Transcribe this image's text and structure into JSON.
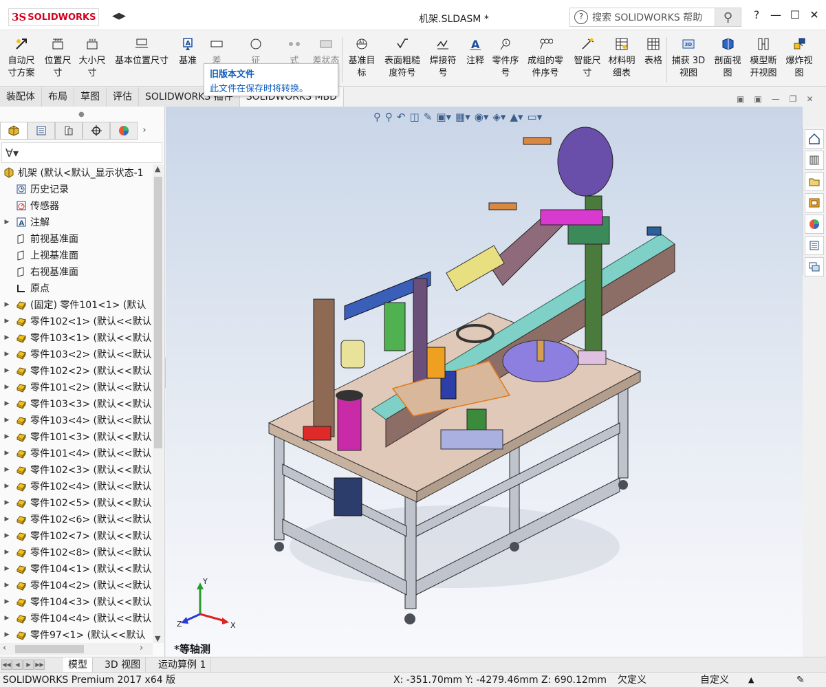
{
  "app": {
    "logo_ds": "3S",
    "logo_text": "SOLIDWORKS",
    "document_title": "机架.SLDASM *",
    "search_placeholder": "搜索 SOLIDWORKS 帮助",
    "help_label": "?"
  },
  "toolbar": {
    "items": [
      {
        "label": "自动尺\n寸方案",
        "icon": "auto-dimension-icon"
      },
      {
        "label": "位置尺\n寸",
        "icon": "location-dimension-icon"
      },
      {
        "label": "大小尺\n寸",
        "icon": "size-dimension-icon"
      },
      {
        "label": "基本位置尺寸",
        "icon": "basic-location-icon"
      },
      {
        "label": "基准",
        "icon": "datum-icon"
      },
      {
        "label": "差",
        "icon": "tolerance-icon"
      },
      {
        "label": "征",
        "icon": "feature-icon"
      },
      {
        "label": "式",
        "icon": "pattern-icon"
      },
      {
        "label": "差状态",
        "icon": "tolerance-status-icon"
      },
      {
        "label": "基准目\n标",
        "icon": "datum-target-icon"
      },
      {
        "label": "表面粗糙\n度符号",
        "icon": "surface-finish-icon"
      },
      {
        "label": "焊接符\n号",
        "icon": "weld-symbol-icon"
      },
      {
        "label": "注释",
        "icon": "note-icon"
      },
      {
        "label": "零件序\n号",
        "icon": "balloon-icon"
      },
      {
        "label": "成组的零\n件序号",
        "icon": "stacked-balloon-icon"
      },
      {
        "label": "智能尺\n寸",
        "icon": "smart-dimension-icon"
      },
      {
        "label": "材料明\n细表",
        "icon": "bom-icon"
      },
      {
        "label": "表格",
        "icon": "table-icon"
      },
      {
        "label": "捕获 3D\n视图",
        "icon": "capture-3d-view-icon"
      },
      {
        "label": "剖面视\n图",
        "icon": "section-view-icon"
      },
      {
        "label": "模型断\n开视图",
        "icon": "break-view-icon"
      },
      {
        "label": "爆炸视\n图",
        "icon": "explode-view-icon"
      }
    ],
    "tooltip_title": "旧版本文件",
    "tooltip_body": "此文件在保存时将转换。"
  },
  "tabs": [
    "装配体",
    "布局",
    "草图",
    "评估",
    "SOLIDWORKS 插件",
    "SOLIDWORKS MBD"
  ],
  "active_tab": "SOLIDWORKS MBD",
  "tree": {
    "root": "机架  (默认<默认_显示状态-1",
    "items": [
      {
        "label": "历史记录",
        "icon": "history-icon",
        "expand": false
      },
      {
        "label": "传感器",
        "icon": "sensor-icon",
        "expand": false
      },
      {
        "label": "注解",
        "icon": "annotation-icon",
        "expand": true
      },
      {
        "label": "前视基准面",
        "icon": "plane-icon",
        "expand": false
      },
      {
        "label": "上视基准面",
        "icon": "plane-icon",
        "expand": false
      },
      {
        "label": "右视基准面",
        "icon": "plane-icon",
        "expand": false
      },
      {
        "label": "原点",
        "icon": "origin-icon",
        "expand": false
      },
      {
        "label": "(固定) 零件101<1> (默认",
        "icon": "part-icon",
        "expand": true
      },
      {
        "label": "零件102<1> (默认<<默认",
        "icon": "part-icon",
        "expand": true
      },
      {
        "label": "零件103<1> (默认<<默认",
        "icon": "part-icon",
        "expand": true
      },
      {
        "label": "零件103<2> (默认<<默认",
        "icon": "part-icon",
        "expand": true
      },
      {
        "label": "零件102<2> (默认<<默认",
        "icon": "part-icon",
        "expand": true
      },
      {
        "label": "零件101<2> (默认<<默认",
        "icon": "part-icon",
        "expand": true
      },
      {
        "label": "零件103<3> (默认<<默认",
        "icon": "part-icon",
        "expand": true
      },
      {
        "label": "零件103<4> (默认<<默认",
        "icon": "part-icon",
        "expand": true
      },
      {
        "label": "零件101<3> (默认<<默认",
        "icon": "part-icon",
        "expand": true
      },
      {
        "label": "零件101<4> (默认<<默认",
        "icon": "part-icon",
        "expand": true
      },
      {
        "label": "零件102<3> (默认<<默认",
        "icon": "part-icon",
        "expand": true
      },
      {
        "label": "零件102<4> (默认<<默认",
        "icon": "part-icon",
        "expand": true
      },
      {
        "label": "零件102<5> (默认<<默认",
        "icon": "part-icon",
        "expand": true
      },
      {
        "label": "零件102<6> (默认<<默认",
        "icon": "part-icon",
        "expand": true
      },
      {
        "label": "零件102<7> (默认<<默认",
        "icon": "part-icon",
        "expand": true
      },
      {
        "label": "零件102<8> (默认<<默认",
        "icon": "part-icon",
        "expand": true
      },
      {
        "label": "零件104<1> (默认<<默认",
        "icon": "part-icon",
        "expand": true
      },
      {
        "label": "零件104<2> (默认<<默认",
        "icon": "part-icon",
        "expand": true
      },
      {
        "label": "零件104<3> (默认<<默认",
        "icon": "part-icon",
        "expand": true
      },
      {
        "label": "零件104<4> (默认<<默认",
        "icon": "part-icon",
        "expand": true
      },
      {
        "label": "零件97<1> (默认<<默认",
        "icon": "part-icon",
        "expand": true
      }
    ]
  },
  "viewport": {
    "view_label": "*等轴测",
    "triad_x": "X",
    "triad_y": "Y",
    "triad_z": "Z"
  },
  "bottom_tabs": [
    "模型",
    "3D 视图",
    "运动算例 1"
  ],
  "active_bottom_tab": "模型",
  "status": {
    "product": "SOLIDWORKS Premium 2017 x64 版",
    "coords": "X: -351.70mm Y: -4279.46mm Z: 690.12mm",
    "state": "欠定义",
    "units": "自定义"
  },
  "colors": {
    "brand": "#d2001f",
    "tooltip": "#0b5dbd"
  }
}
